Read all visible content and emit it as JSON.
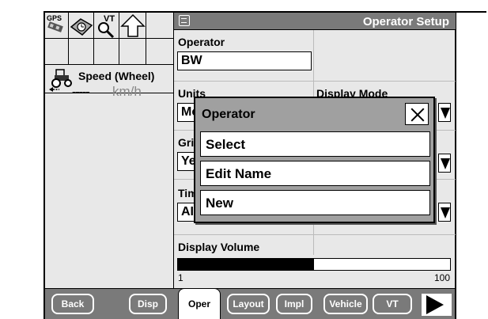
{
  "status": {
    "icons": [
      "gps-icon",
      "map-icon",
      "vt-search-icon",
      "up-arrow-icon"
    ],
    "gps_label": "GPS",
    "vt_label": "VT",
    "speed_label": "Speed (Wheel)",
    "speed_value": "-----",
    "speed_unit": "km/h"
  },
  "header": {
    "title": "Operator Setup"
  },
  "form": {
    "operator_label": "Operator",
    "operator_value": "BW",
    "units_label": "Units",
    "units_value": "Me",
    "display_mode_label": "Display Mode",
    "grid_label": "Gri",
    "grid_value": "Ye",
    "time_label": "Tim",
    "time_value": "AI",
    "volume_label": "Display Volume",
    "volume_level_percent": 50,
    "volume_min": "1",
    "volume_max": "100"
  },
  "dialog": {
    "title": "Operator",
    "options": [
      "Select",
      "Edit Name",
      "New"
    ]
  },
  "tabs": {
    "back": "Back",
    "disp": "Disp",
    "oper": "Oper",
    "layout": "Layout",
    "impl": "Impl",
    "vehicle": "Vehicle",
    "vt": "VT"
  },
  "colors": {
    "title_bar": "#7a7a7a",
    "panel_bg": "#e8e8e8"
  }
}
